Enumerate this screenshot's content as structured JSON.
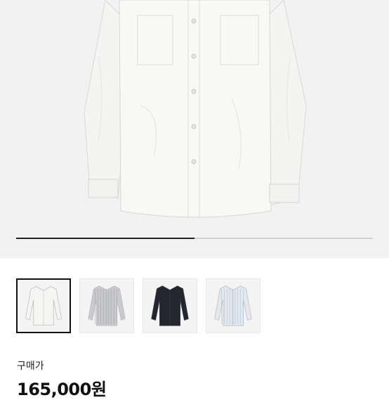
{
  "gallery": {
    "progress": 0.5,
    "colors": {
      "background": "#f2f2f2",
      "shirt": "#f7f7f5",
      "indicator": "#222222",
      "track": "#cfcfcf"
    }
  },
  "thumbnails": [
    {
      "name": "white-shirt",
      "color": "#f5f5f3",
      "stripe": "",
      "selected": true
    },
    {
      "name": "gray-stripe-shirt",
      "color": "#c9cacd",
      "stripe": "#9ea1a6",
      "selected": false
    },
    {
      "name": "navy-shirt",
      "color": "#23262f",
      "stripe": "",
      "selected": false
    },
    {
      "name": "blue-stripe-shirt",
      "color": "#e3e9ef",
      "stripe": "#a9bed2",
      "selected": false
    }
  ],
  "purchase": {
    "label": "구매가",
    "price": "165,000원"
  }
}
